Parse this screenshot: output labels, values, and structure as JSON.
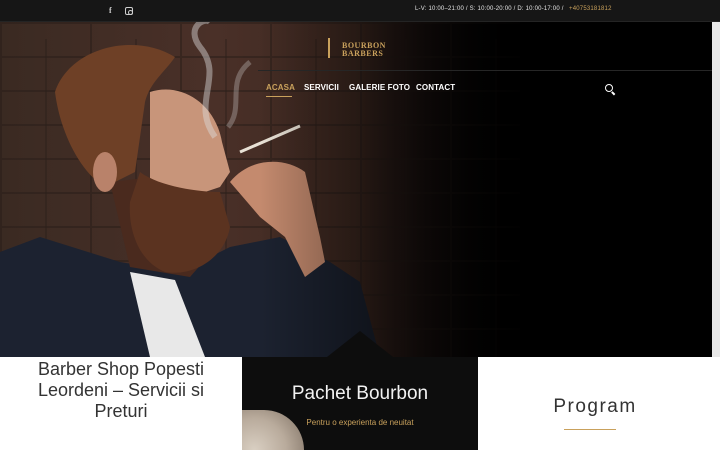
{
  "topbar": {
    "social": [
      "facebook-icon",
      "instagram-icon"
    ],
    "hours": "L-V: 10:00–21:00 / S: 10:00-20:00 / D: 10:00-17:00  /",
    "phone": "+40753181812"
  },
  "logo": {
    "line1": "BOURBON",
    "line2": "BARBERS"
  },
  "nav": {
    "items": [
      "ACASA",
      "SERVICII",
      "GALERIE FOTO",
      "CONTACT"
    ],
    "active": "ACASA"
  },
  "panels": {
    "left_title": "Barber Shop Popesti Leordeni – Servicii si Preturi",
    "center_title": "Pachet Bourbon",
    "center_subtitle": "Pentru o experienta de neuitat",
    "right_title": "Program"
  },
  "colors": {
    "accent": "#c9a15c",
    "topbar": "#161616",
    "dark_panel": "#0d0d0d"
  }
}
